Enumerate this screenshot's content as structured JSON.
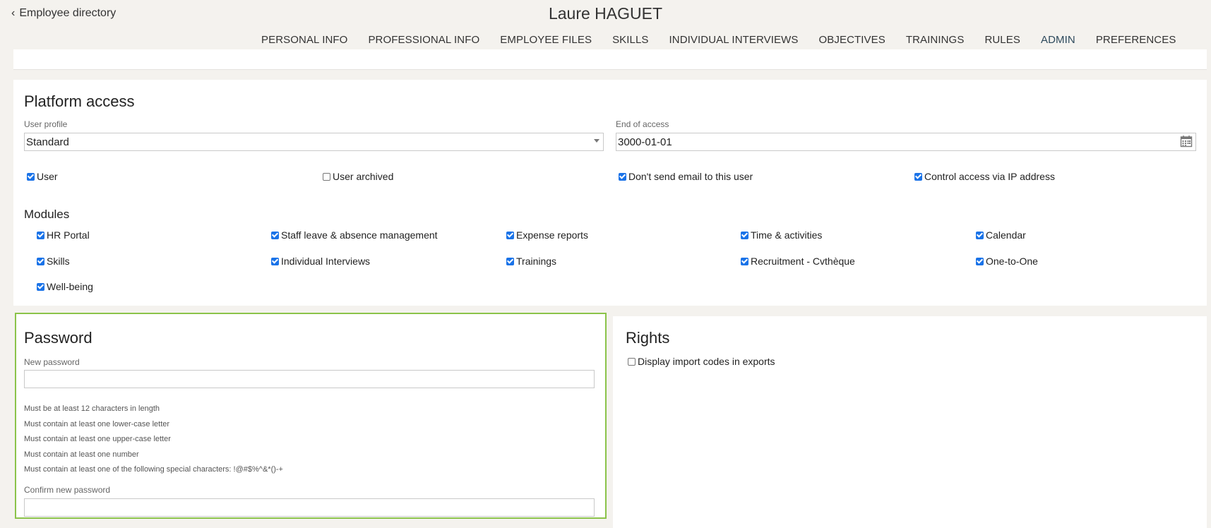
{
  "header": {
    "back_label": "Employee directory",
    "employee_name": "Laure HAGUET",
    "tabs": [
      {
        "label": "PERSONAL INFO"
      },
      {
        "label": "PROFESSIONAL INFO"
      },
      {
        "label": "EMPLOYEE FILES"
      },
      {
        "label": "SKILLS"
      },
      {
        "label": "INDIVIDUAL INTERVIEWS"
      },
      {
        "label": "OBJECTIVES"
      },
      {
        "label": "TRAININGS"
      },
      {
        "label": "RULES"
      },
      {
        "label": "ADMIN"
      },
      {
        "label": "PREFERENCES"
      }
    ],
    "active_tab": "ADMIN"
  },
  "platform_access": {
    "title": "Platform access",
    "user_profile_label": "User profile",
    "user_profile_value": "Standard",
    "end_of_access_label": "End of access",
    "end_of_access_value": "3000-01-01",
    "flags": [
      {
        "label": "User",
        "checked": true
      },
      {
        "label": "User archived",
        "checked": false
      },
      {
        "label": "Don't send email to this user",
        "checked": true
      },
      {
        "label": "Control access via IP address",
        "checked": true
      }
    ],
    "modules_title": "Modules",
    "modules": [
      {
        "label": "HR Portal",
        "checked": true
      },
      {
        "label": "Staff leave & absence management",
        "checked": true
      },
      {
        "label": "Expense reports",
        "checked": true
      },
      {
        "label": "Time & activities",
        "checked": true
      },
      {
        "label": "Calendar",
        "checked": true
      },
      {
        "label": "Skills",
        "checked": true
      },
      {
        "label": "Individual Interviews",
        "checked": true
      },
      {
        "label": "Trainings",
        "checked": true
      },
      {
        "label": "Recruitment - Cvthèque",
        "checked": true
      },
      {
        "label": "One-to-One",
        "checked": true
      },
      {
        "label": "Well-being",
        "checked": true
      }
    ]
  },
  "password": {
    "title": "Password",
    "new_label": "New password",
    "new_value": "",
    "rules": [
      "Must be at least 12 characters in length",
      "Must contain at least one lower-case letter",
      "Must contain at least one upper-case letter",
      "Must contain at least one number",
      "Must contain at least one of the following special characters: !@#$%^&*()-+"
    ],
    "confirm_label": "Confirm new password",
    "confirm_value": ""
  },
  "rights": {
    "title": "Rights",
    "options": [
      {
        "label": "Display import codes in exports",
        "checked": false
      }
    ]
  },
  "colors": {
    "accent_tab": "#2e4a5c",
    "checkbox_blue": "#1a73e8",
    "focus_border": "#8bc34a",
    "page_bg": "#f4f2ee"
  },
  "icons": {
    "back": "chevron-left-icon",
    "calendar": "calendar-icon",
    "dropdown": "caret-down-icon"
  }
}
